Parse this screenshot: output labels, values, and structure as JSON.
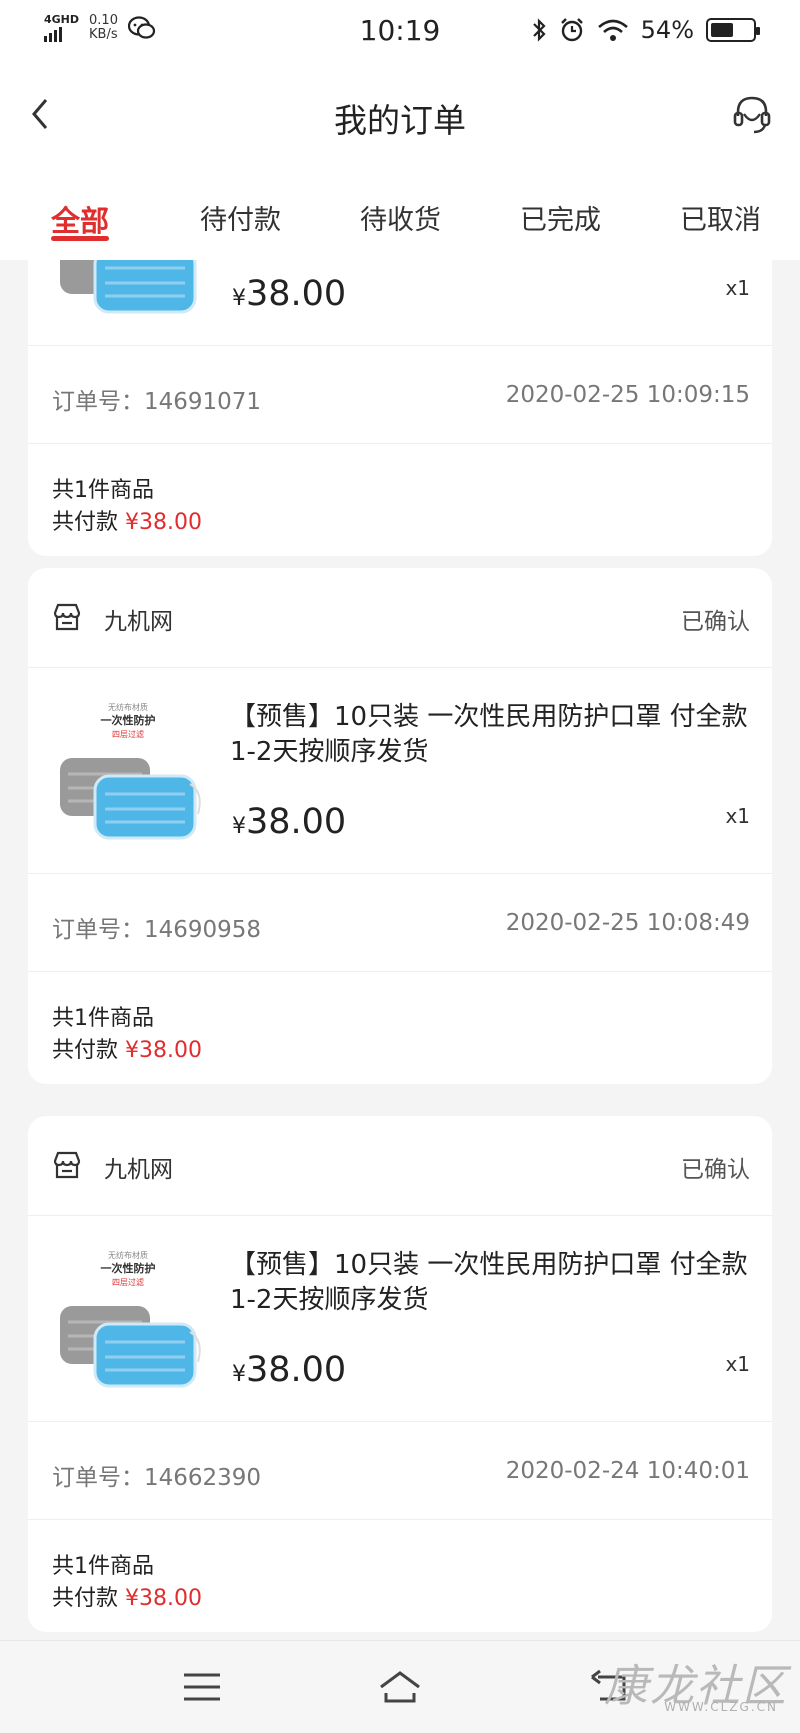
{
  "status_bar": {
    "network_type": "4GHD",
    "net_speed_value": "0.10",
    "net_speed_unit": "KB/s",
    "time": "10:19",
    "battery_percent": "54%",
    "battery_level": 0.54
  },
  "header": {
    "title": "我的订单"
  },
  "tabs": [
    {
      "label": "全部",
      "active": true
    },
    {
      "label": "待付款",
      "active": false
    },
    {
      "label": "待收货",
      "active": false
    },
    {
      "label": "已完成",
      "active": false
    },
    {
      "label": "已取消",
      "active": false
    }
  ],
  "orders": [
    {
      "product_price_currency": "¥",
      "product_price": "38.00",
      "quantity": "x1",
      "order_no_label": "订单号：",
      "order_no": "14691071",
      "order_time": "2020-02-25 10:09:15",
      "count_text": "共1件商品",
      "paid_label": "共付款",
      "paid_amount": "¥38.00"
    },
    {
      "shop_name": "九机网",
      "status": "已确认",
      "product_name": "【预售】10只装 一次性民用防护口罩 付全款1-2天按顺序发货",
      "product_price_currency": "¥",
      "product_price": "38.00",
      "quantity": "x1",
      "order_no_label": "订单号：",
      "order_no": "14690958",
      "order_time": "2020-02-25 10:08:49",
      "count_text": "共1件商品",
      "paid_label": "共付款",
      "paid_amount": "¥38.00"
    },
    {
      "shop_name": "九机网",
      "status": "已确认",
      "product_name": "【预售】10只装 一次性民用防护口罩 付全款1-2天按顺序发货",
      "product_price_currency": "¥",
      "product_price": "38.00",
      "quantity": "x1",
      "order_no_label": "订单号：",
      "order_no": "14662390",
      "order_time": "2020-02-24 10:40:01",
      "count_text": "共1件商品",
      "paid_label": "共付款",
      "paid_amount": "¥38.00"
    }
  ],
  "product_image_text": {
    "line1": "无纺布材质",
    "line2": "一次性防护",
    "line3": "四层过滤"
  },
  "watermark": {
    "text": "康龙社区",
    "url": "WWW.CLZG.CN"
  },
  "colors": {
    "accent": "#e02e2e",
    "mask_blue": "#4fb6e8",
    "mask_gray": "#9a9a9a"
  },
  "icons": {
    "back": "chevron-left-icon",
    "customer_service": "headset-icon",
    "shop": "store-icon",
    "menu": "menu-icon",
    "home": "home-icon",
    "back_nav": "back-arrow-icon"
  }
}
